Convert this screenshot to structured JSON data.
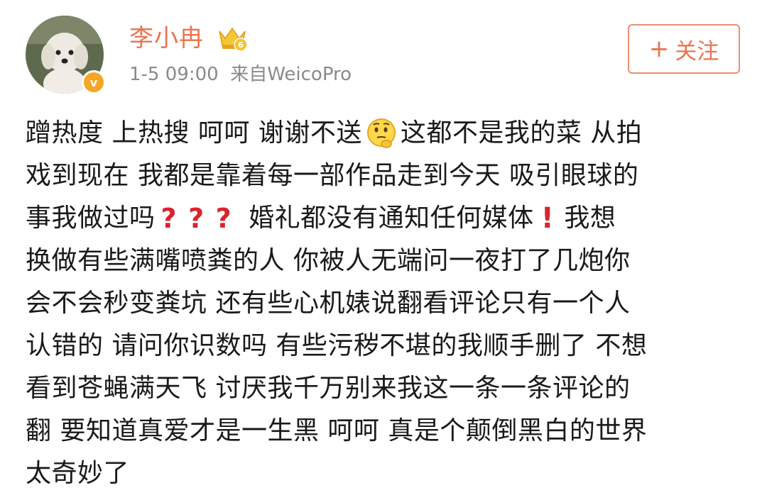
{
  "user": {
    "name": "李小冉",
    "timestamp": "1-5 09:00",
    "source_prefix": "来自",
    "source": "WeicoPro",
    "vip_level": "6",
    "verified_mark": "v"
  },
  "follow": {
    "plus": "+",
    "label": "关注"
  },
  "post": {
    "l1a": "蹭热度 上热搜 呵呵 谢谢不送",
    "l1b": "这都不是我的菜 从拍",
    "l2": "戏到现在 我都是靠着每一部作品走到今天 吸引眼球的",
    "l3a": "事我做过吗",
    "q": "?",
    "l3b": "婚礼都没有通知任何媒体",
    "ex": "!",
    "l3c": "我想",
    "l4": "换做有些满嘴喷粪的人 你被人无端问一夜打了几炮你",
    "l5": "会不会秒变粪坑 还有些心机婊说翻看评论只有一个人",
    "l6": "认错的 请问你识数吗 有些污秽不堪的我顺手删了 不想",
    "l7": "看到苍蝇满天飞 讨厌我千万别来我这一条一条评论的",
    "l8": "翻 要知道真爱才是一生黑 呵呵 真是个颠倒黑白的世界",
    "l9": "太奇妙了"
  },
  "icons": {
    "emoji": "thinking-face-icon",
    "question": "red-question-mark-icon",
    "exclamation": "red-exclamation-icon",
    "vip": "crown-vip-icon",
    "verified": "verified-v-badge-icon"
  },
  "colors": {
    "username": "#eb7350",
    "meta": "#8a8a8a",
    "follow_border": "#eb9070",
    "emphasis_red": "#d8242f",
    "verified_badge": "#f5a623"
  }
}
